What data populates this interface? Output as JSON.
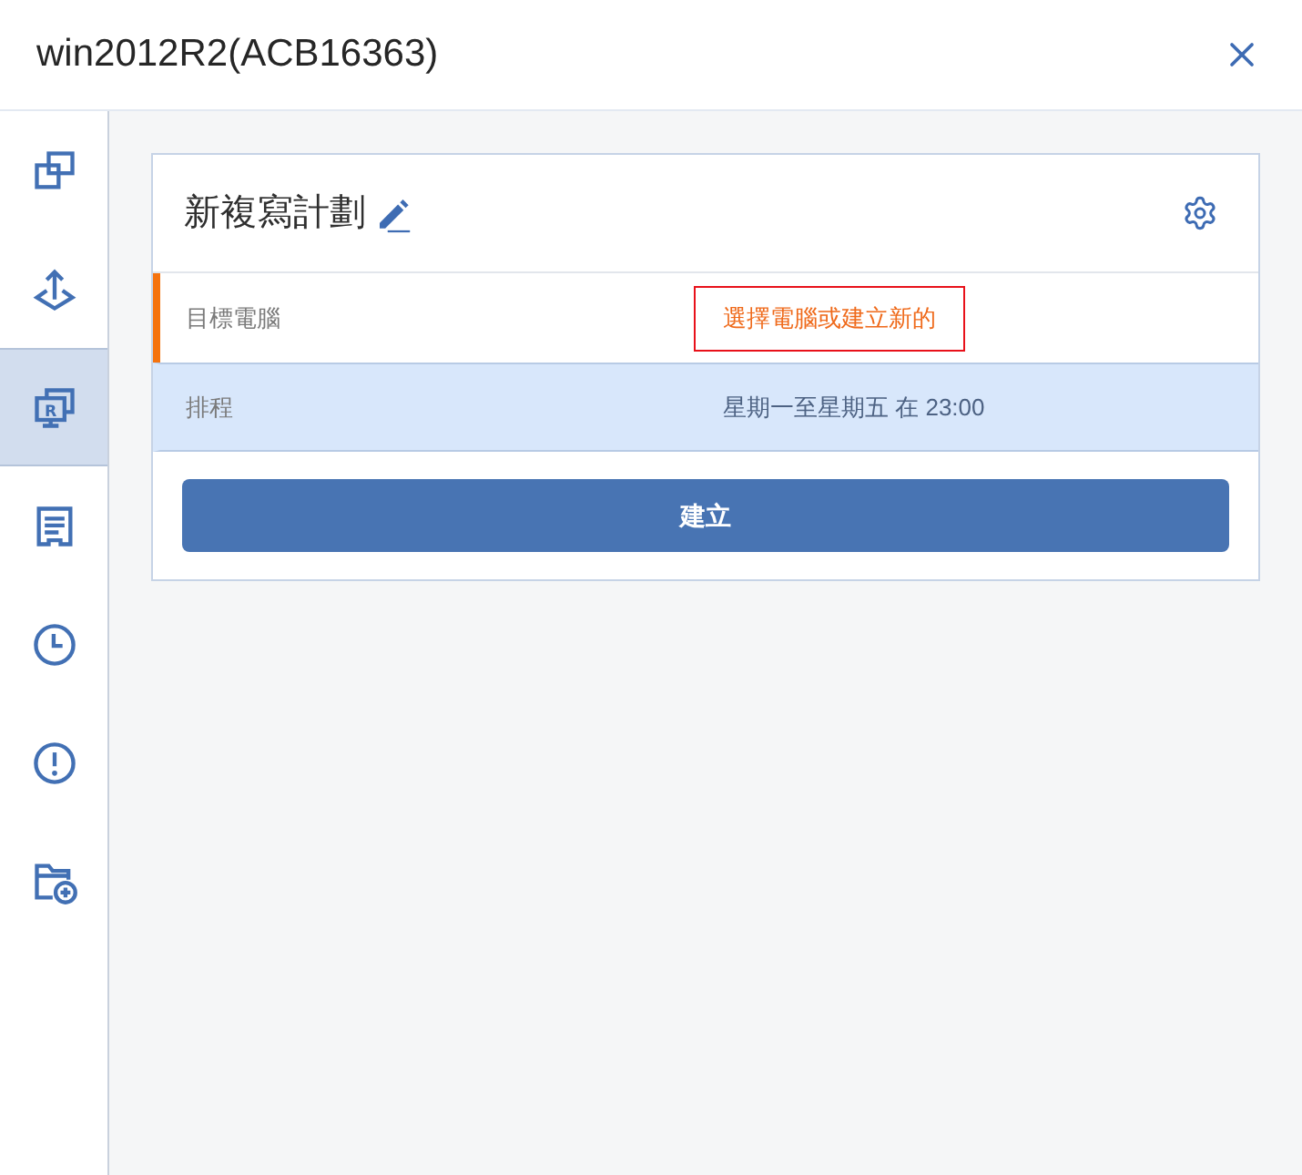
{
  "window": {
    "title": "win2012R2(ACB16363)"
  },
  "sidebar": {
    "items": [
      {
        "kind": "copies",
        "selected": false
      },
      {
        "kind": "upload",
        "selected": false
      },
      {
        "kind": "replica",
        "badge": "R",
        "selected": true
      },
      {
        "kind": "log",
        "selected": false
      },
      {
        "kind": "schedule",
        "selected": false
      },
      {
        "kind": "alert",
        "selected": false
      },
      {
        "kind": "add-folder",
        "selected": false
      }
    ]
  },
  "plan": {
    "title": "新複寫計劃",
    "rows": [
      {
        "label": "目標電腦",
        "value": "選擇電腦或建立新的",
        "warning": true,
        "highlighted": true,
        "selected": false
      },
      {
        "label": "排程",
        "value": "星期一至星期五 在 23:00",
        "warning": false,
        "highlighted": false,
        "selected": true
      }
    ],
    "button": {
      "label": "建立"
    }
  }
}
